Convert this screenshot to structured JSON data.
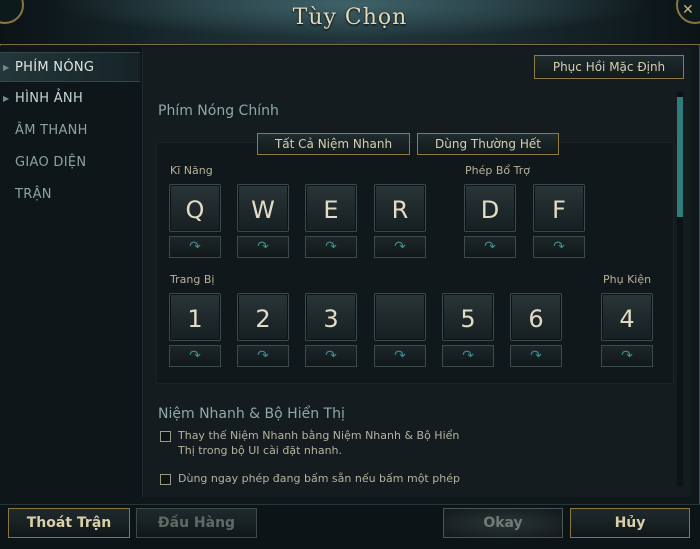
{
  "window": {
    "title": "Tùy Chọn"
  },
  "sidebar": {
    "items": [
      {
        "label": "PHÍM NÓNG"
      },
      {
        "label": "HÌNH ẢNH"
      },
      {
        "label": "ÂM THANH"
      },
      {
        "label": "GIAO DIỆN"
      },
      {
        "label": "TRẬN"
      }
    ]
  },
  "main": {
    "restore_defaults": "Phục Hồi Mặc Định",
    "hotkeys_title": "Phím Nóng Chính",
    "quickcast_all": "Tất Cả Niệm Nhanh",
    "normal_all": "Dùng Thường Hết",
    "groups": {
      "skills": "Kĩ Năng",
      "summoner": "Phép Bổ Trợ",
      "items": "Trang Bị",
      "trinket": "Phụ Kiện"
    },
    "skill_keys": [
      "Q",
      "W",
      "E",
      "R"
    ],
    "summoner_keys": [
      "D",
      "F"
    ],
    "item_keys": [
      "1",
      "2",
      "3",
      "",
      "5",
      "6"
    ],
    "trinket_key": "4",
    "quickcast_title": "Niệm Nhanh & Bộ Hiển Thị",
    "options": [
      {
        "text": "Thay thế Niệm Nhanh bằng Niệm Nhanh & Bộ Hiển Thị trong bộ UI cài đặt nhanh.",
        "checked": false
      },
      {
        "text": "Dùng ngay phép đang bấm sẵn nếu bấm một phép khác",
        "checked": false
      }
    ]
  },
  "footer": {
    "quit_game": "Thoát Trận",
    "surrender": "Đầu Hàng",
    "okay": "Okay",
    "cancel": "Hủy"
  },
  "colors": {
    "accent": "#2f7d7c",
    "gold_border": "#8d7a45"
  },
  "icons": {
    "cast_arrow": "curved-arrow-icon",
    "nav_marker": "triangle-right-icon"
  }
}
